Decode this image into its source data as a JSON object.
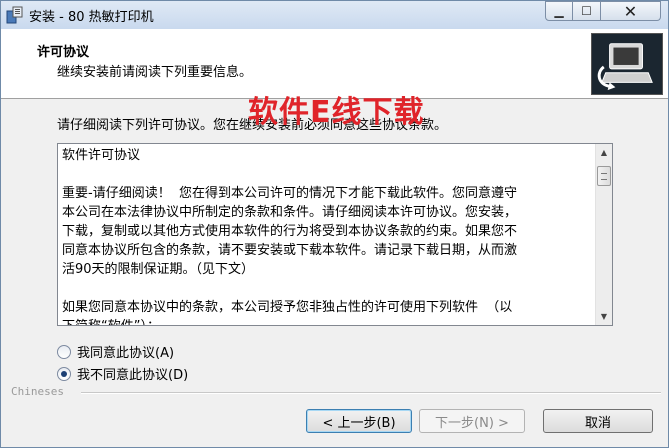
{
  "window": {
    "title": "安装 - 80 热敏打印机",
    "minimize_glyph": "▁",
    "maximize_glyph": "☐",
    "close_glyph": "✕"
  },
  "header": {
    "title": "许可协议",
    "subtitle": "继续安装前请阅读下列重要信息。"
  },
  "watermark": "软件E线下载",
  "intro": "请仔细阅读下列许可协议。您在继续安装前必须同意这些协议条款。",
  "license": {
    "lines": [
      "软件许可协议",
      "",
      "重要-请仔细阅读！  您在得到本公司许可的情况下才能下载此软件。您同意遵守",
      "本公司在本法律协议中所制定的条款和条件。请仔细阅读本许可协议。您安装，",
      "下载，复制或以其他方式使用本软件的行为将受到本协议条款的约束。如果您不",
      "同意本协议所包含的条款，请不要安装或下载本软件。请记录下载日期，从而激",
      "活90天的限制保证期。（见下文）",
      "",
      "如果您同意本协议中的条款，本公司授予您非独占性的许可使用下列软件  （以",
      "下简称“软件”）："
    ]
  },
  "radios": {
    "accept": "我同意此协议(A)",
    "decline": "我不同意此协议(D)",
    "selected": "decline"
  },
  "separator_label": "Chineses",
  "buttons": {
    "back": "< 上一步(B)",
    "next": "下一步(N) >",
    "cancel": "取消"
  },
  "colors": {
    "watermark": "#e0242a",
    "header_bg": "#ffffff",
    "body_bg": "#f0f0f0"
  }
}
